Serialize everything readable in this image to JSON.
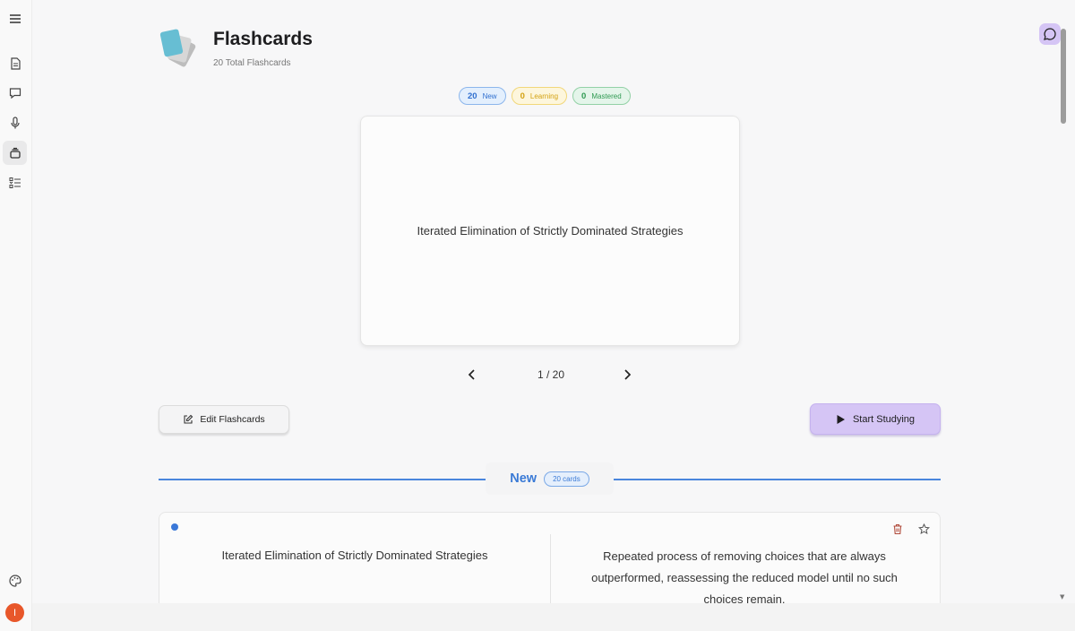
{
  "header": {
    "title": "Flashcards",
    "subtitle": "20 Total Flashcards"
  },
  "badges": [
    {
      "count": "20",
      "label": "New",
      "color": "#2f6fcf"
    },
    {
      "count": "0",
      "label": "Learning",
      "color": "#d3a110"
    },
    {
      "count": "0",
      "label": "Mastered",
      "color": "#2f9a52"
    }
  ],
  "card": {
    "text": "Iterated Elimination of Strictly Dominated Strategies"
  },
  "pager": {
    "label": "1 / 20",
    "prev_icon": "chevron-left-icon",
    "next_icon": "chevron-right-icon"
  },
  "actions": {
    "edit_label": "Edit Flashcards",
    "study_label": "Start Studying"
  },
  "section": {
    "title": "New",
    "count": "20 cards"
  },
  "list": [
    {
      "front": "Iterated Elimination of Strictly Dominated Strategies",
      "back": "Repeated process of removing choices that are always outperformed, reassessing the reduced model until no such choices remain."
    }
  ],
  "sidebar": {
    "items": [
      "menu-icon",
      "document-icon",
      "chat-icon",
      "microphone-icon",
      "flashcards-icon",
      "checklist-icon"
    ],
    "bottom": [
      "palette-icon"
    ],
    "avatar": "I"
  },
  "colors": {
    "accent": "#4a86dd",
    "study_button": "#d5c5f5",
    "avatar": "#e8572a"
  }
}
